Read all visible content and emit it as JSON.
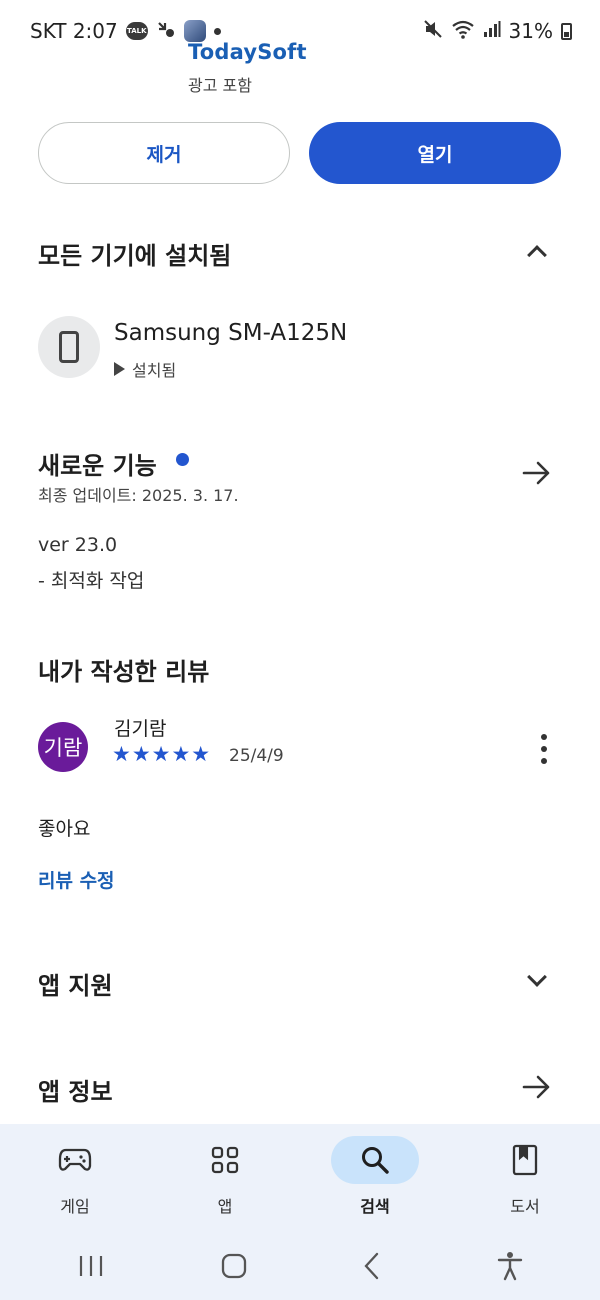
{
  "status_bar": {
    "carrier_time": "SKT 2:07",
    "talk_badge": "TALK",
    "battery": "31%"
  },
  "app_header": {
    "developer": "TodaySoft",
    "ads_label": "광고 포함"
  },
  "actions": {
    "remove_label": "제거",
    "open_label": "열기"
  },
  "installed_section": {
    "title": "모든 기기에 설치됨",
    "device_name": "Samsung SM-A125N",
    "device_status": "설치됨"
  },
  "whats_new": {
    "title": "새로운 기능",
    "updated": "최종 업데이트: 2025. 3. 17.",
    "version": "ver 23.0",
    "change": "- 최적화 작업"
  },
  "my_review": {
    "title": "내가 작성한 리뷰",
    "avatar_text": "기람",
    "reviewer": "김기람",
    "stars": "★★★★★",
    "rating": 5,
    "date": "25/4/9",
    "body": "좋아요",
    "edit_label": "리뷰 수정"
  },
  "app_support": {
    "title": "앱 지원"
  },
  "app_info": {
    "title": "앱 정보"
  },
  "bottom_nav": [
    {
      "label": "게임",
      "icon": "gamepad-icon"
    },
    {
      "label": "앱",
      "icon": "apps-grid-icon"
    },
    {
      "label": "검색",
      "icon": "search-icon",
      "active": true
    },
    {
      "label": "도서",
      "icon": "book-icon"
    }
  ],
  "colors": {
    "accent": "#2356cf",
    "link": "#1a5fb4",
    "nav_background": "#edf2fa",
    "nav_active_pill": "#c9e3fb",
    "review_avatar": "#6a1b9a"
  }
}
